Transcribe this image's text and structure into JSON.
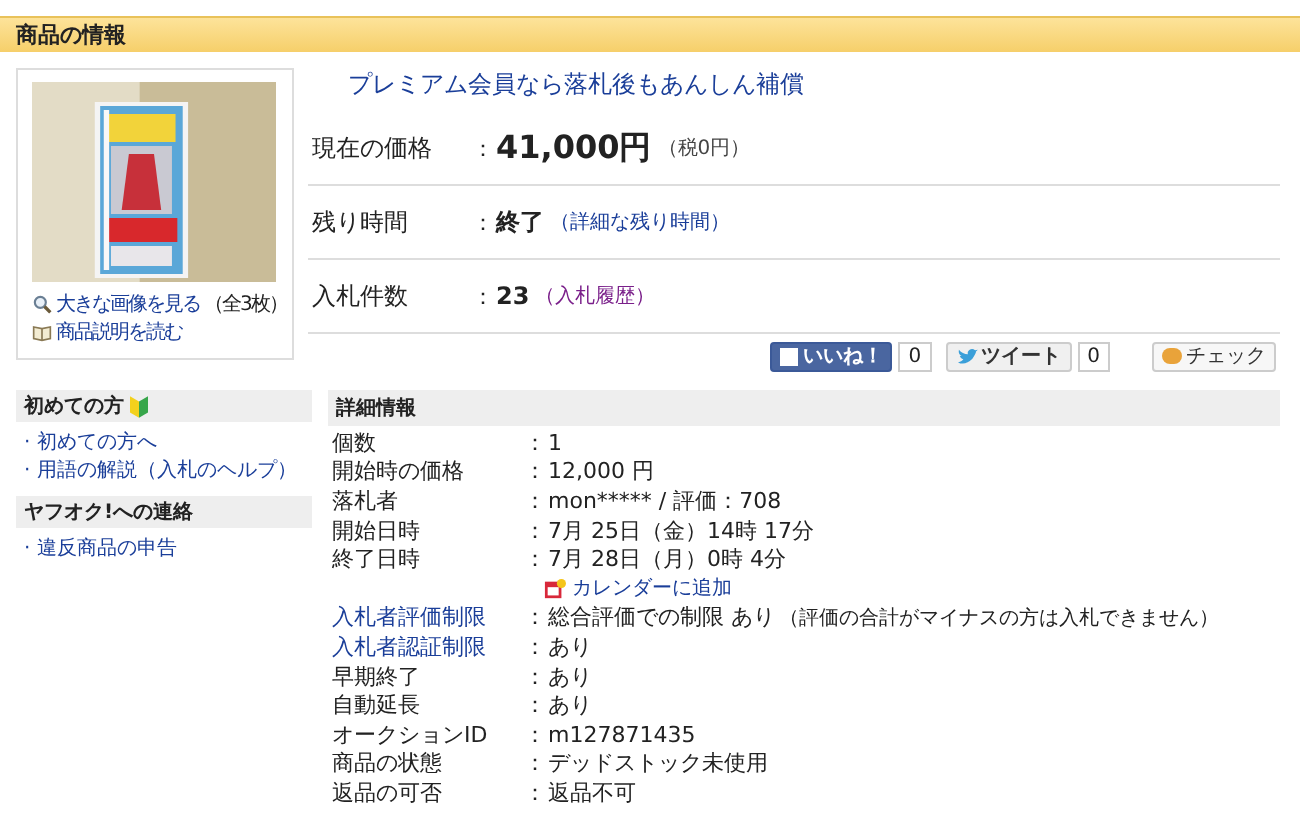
{
  "header": {
    "title": "商品の情報"
  },
  "image_panel": {
    "links": [
      {
        "kind": "zoom",
        "text": "大きな画像を見る",
        "note": "（全3枚）"
      },
      {
        "kind": "book",
        "text": "商品説明を読む"
      }
    ]
  },
  "promo": "プレミアム会員なら落札後もあんしん補償",
  "summary": [
    {
      "label": "現在の価格",
      "sep": "：",
      "value": "41,000円",
      "big": true,
      "note": "（税0円）",
      "note_link": false,
      "note_visited": false
    },
    {
      "label": "残り時間",
      "sep": "：",
      "value": "終了",
      "big": false,
      "note": "（詳細な残り時間）",
      "note_link": true,
      "note_visited": false
    },
    {
      "label": "入札件数",
      "sep": "：",
      "value": "23",
      "big": false,
      "note": "（入札履歴）",
      "note_link": true,
      "note_visited": true
    }
  ],
  "social": [
    {
      "kind": "like",
      "label": "いいね！",
      "count": "0"
    },
    {
      "kind": "tweet",
      "label": "ツイート",
      "count": "0"
    },
    {
      "kind": "check",
      "label": "チェック"
    }
  ],
  "sidebar": [
    {
      "title": "初めての方",
      "beginner_mark": true,
      "items": [
        "· 初めての方へ",
        "· 用語の解説（入札のヘルプ）"
      ]
    },
    {
      "title": "ヤフオク!への連絡",
      "beginner_mark": false,
      "items": [
        "· 違反商品の申告"
      ]
    }
  ],
  "details": {
    "title": "詳細情報",
    "rows": [
      {
        "kind": "row",
        "label": "個数",
        "label_link": false,
        "sep": "：",
        "value": "1"
      },
      {
        "kind": "row",
        "label": "開始時の価格",
        "label_link": false,
        "sep": "：",
        "value": "12,000 円"
      },
      {
        "kind": "row",
        "label": "落札者",
        "label_link": false,
        "sep": "：",
        "value": "mon***** / 評価：708"
      },
      {
        "kind": "row",
        "label": "開始日時",
        "label_link": false,
        "sep": "：",
        "value": "7月 25日（金）14時 17分"
      },
      {
        "kind": "row",
        "label": "終了日時",
        "label_link": false,
        "sep": "：",
        "value": "7月 28日（月）0時 4分"
      },
      {
        "kind": "calendar",
        "value": "カレンダーに追加"
      },
      {
        "kind": "row",
        "label": "入札者評価制限",
        "label_link": true,
        "sep": "：",
        "value": "総合評価での制限 あり",
        "note": "（評価の合計がマイナスの方は入札できません）"
      },
      {
        "kind": "row",
        "label": "入札者認証制限",
        "label_link": true,
        "sep": "：",
        "value": "あり"
      },
      {
        "kind": "row",
        "label": "早期終了",
        "label_link": false,
        "sep": "：",
        "value": "あり"
      },
      {
        "kind": "row",
        "label": "自動延長",
        "label_link": false,
        "sep": "：",
        "value": "あり"
      },
      {
        "kind": "row",
        "label": "オークションID",
        "label_link": false,
        "sep": "：",
        "value": "m127871435"
      },
      {
        "kind": "row",
        "label": "商品の状態",
        "label_link": false,
        "sep": "：",
        "value": "デッドストック未使用"
      },
      {
        "kind": "row",
        "label": "返品の可否",
        "label_link": false,
        "sep": "：",
        "value": "返品不可"
      }
    ]
  }
}
